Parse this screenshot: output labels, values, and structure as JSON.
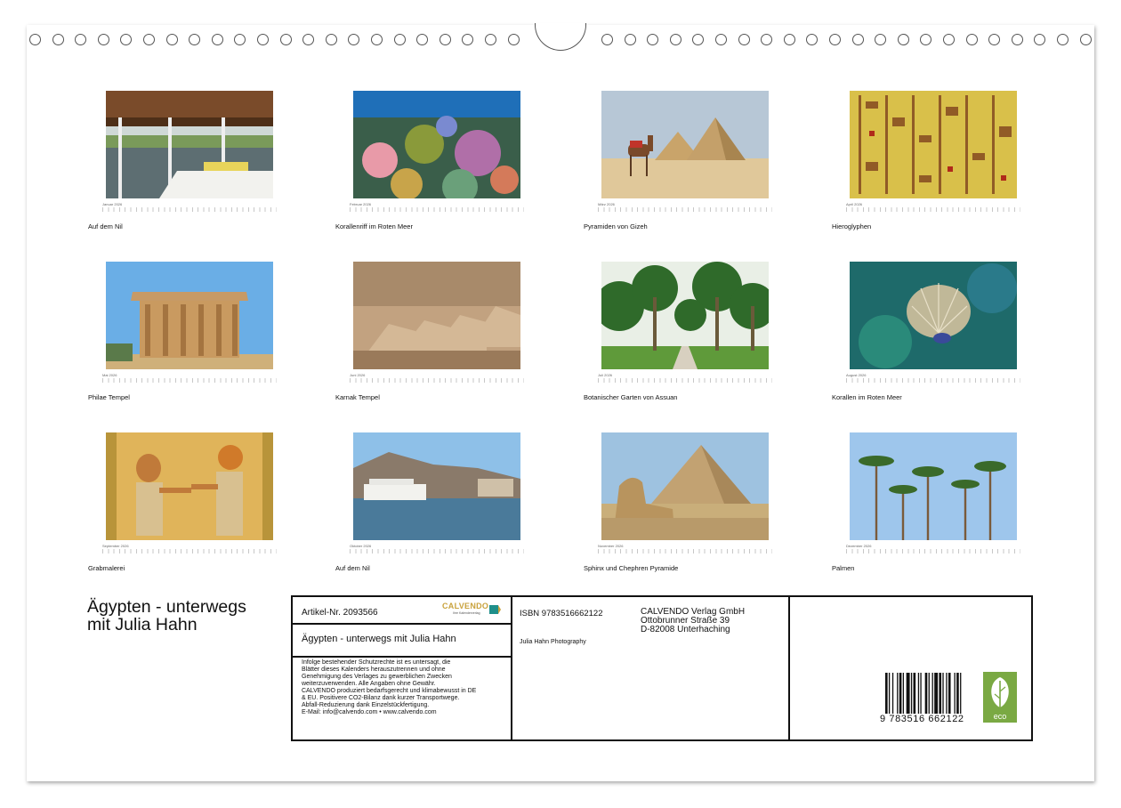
{
  "calendar": {
    "months": [
      {
        "month": "Januar 2026",
        "caption": "Auf dem Nil",
        "icon": "nile-boat-photo"
      },
      {
        "month": "Februar 2026",
        "caption": "Korallenriff im Roten Meer",
        "icon": "coral-reef-photo"
      },
      {
        "month": "März 2026",
        "caption": "Pyramiden von Gizeh",
        "icon": "pyramids-camel-photo"
      },
      {
        "month": "April 2026",
        "caption": "Hieroglyphen",
        "icon": "hieroglyphs-photo"
      },
      {
        "month": "Mai 2026",
        "caption": "Philae Tempel",
        "icon": "philae-temple-photo"
      },
      {
        "month": "Juni 2026",
        "caption": "Karnak Tempel",
        "icon": "karnak-sphinx-photo"
      },
      {
        "month": "Juli 2026",
        "caption": "Botanischer Garten von Assuan",
        "icon": "botanical-garden-photo"
      },
      {
        "month": "August 2026",
        "caption": "Korallen im Roten Meer",
        "icon": "coral-photo"
      },
      {
        "month": "September 2026",
        "caption": "Grabmalerei",
        "icon": "tomb-painting-photo"
      },
      {
        "month": "Oktober 2026",
        "caption": "Auf dem Nil",
        "icon": "nile-shore-photo"
      },
      {
        "month": "November 2026",
        "caption": "Sphinx und Chephren Pyramide",
        "icon": "sphinx-pyramid-photo"
      },
      {
        "month": "Dezember 2026",
        "caption": "Palmen",
        "icon": "palm-trees-photo"
      }
    ]
  },
  "title": {
    "line1": "Ägypten - unterwegs",
    "line2": "mit Julia Hahn"
  },
  "info": {
    "article": "Artikel-Nr. 2093566",
    "logo_text": "CALVENDO",
    "logo_sub": "Ihre Kalenderverlag",
    "calendar_title": "Ägypten - unterwegs mit Julia Hahn",
    "legal": [
      "Infolge bestehender Schutzrechte ist es untersagt, die",
      "Blätter dieses Kalenders herauszutrennen und ohne",
      "Genehmigung des Verlages zu gewerblichen Zwecken",
      "weiterzuverwenden. Alle Angaben ohne Gewähr.",
      "CALVENDO produziert bedarfsgerecht und klimabewusst in DE",
      "& EU. Positivere CO2-Bilanz dank kurzer Transportwege.",
      "Abfall-Reduzierung dank Einzelstückfertigung.",
      "E-Mail: info@calvendo.com • www.calvendo.com"
    ],
    "isbn": "ISBN 9783516662122",
    "publisher": [
      "CALVENDO Verlag GmbH",
      "Ottobrunner Straße 39",
      "D-82008 Unterhaching"
    ],
    "author": "Julia Hahn Photography",
    "barcode_number": "9 783516 662122",
    "eco_label": "eco"
  },
  "colors": {
    "eco_green": "#7aa943",
    "calvendo_gold": "#c9a23c",
    "calvendo_teal": "#1f8f8a"
  }
}
